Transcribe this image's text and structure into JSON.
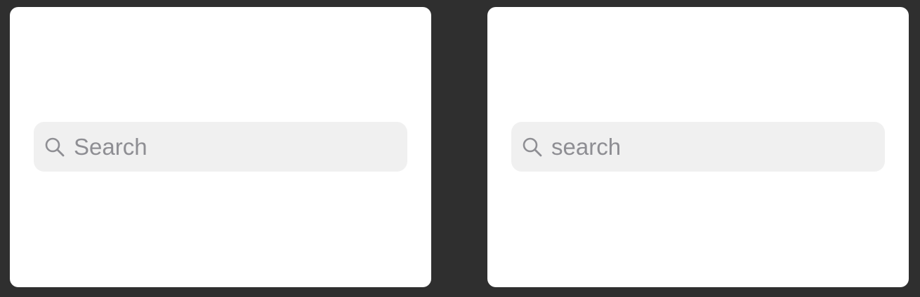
{
  "panels": [
    {
      "search": {
        "placeholder": "Search",
        "value": "",
        "icon": "search-icon"
      }
    },
    {
      "search": {
        "placeholder": "search",
        "value": "",
        "icon": "search-icon"
      }
    }
  ],
  "colors": {
    "background": "#2f2f2f",
    "panel": "#ffffff",
    "field": "#f0f0f0",
    "placeholder": "#8e8e93"
  }
}
